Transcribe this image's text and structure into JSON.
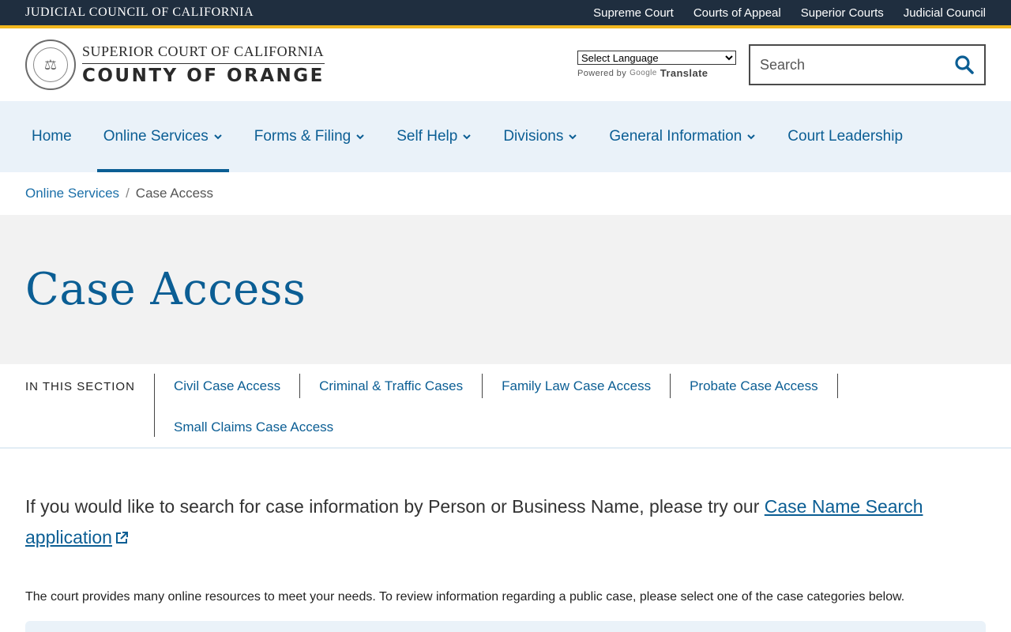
{
  "topbar": {
    "title": "JUDICIAL COUNCIL OF CALIFORNIA",
    "links": [
      "Supreme Court",
      "Courts of Appeal",
      "Superior Courts",
      "Judicial Council"
    ]
  },
  "header": {
    "brand_top": "SUPERIOR COURT OF CALIFORNIA",
    "brand_bottom": "COUNTY OF ORANGE",
    "language_select": "Select Language",
    "powered_by": "Powered by",
    "google": "Google",
    "translate": "Translate",
    "search_placeholder": "Search"
  },
  "nav": {
    "items": [
      {
        "label": "Home"
      },
      {
        "label": "Online Services"
      },
      {
        "label": "Forms & Filing"
      },
      {
        "label": "Self Help"
      },
      {
        "label": "Divisions"
      },
      {
        "label": "General Information"
      },
      {
        "label": "Court Leadership"
      }
    ]
  },
  "breadcrumb": {
    "parent": "Online Services",
    "separator": "/",
    "current": "Case Access"
  },
  "hero": {
    "title": "Case Access"
  },
  "in_section": {
    "label": "IN THIS SECTION",
    "links": [
      "Civil Case Access",
      "Criminal & Traffic Cases",
      "Family Law Case Access",
      "Probate Case Access",
      "Small Claims Case Access"
    ]
  },
  "content": {
    "lead_text": "If you would like to search for case information by Person or Business Name, please try our ",
    "lead_link": "Case Name Search application",
    "body": "The court provides many online resources to meet your needs. To review information regarding a public case, please select one of the case categories below."
  },
  "colors": {
    "brand_blue": "#0b5e94",
    "topbar_bg": "#1f2e3f",
    "accent_gold": "#f2b71e",
    "nav_bg": "#eaf2f9",
    "hero_bg": "#f2f2f2"
  }
}
